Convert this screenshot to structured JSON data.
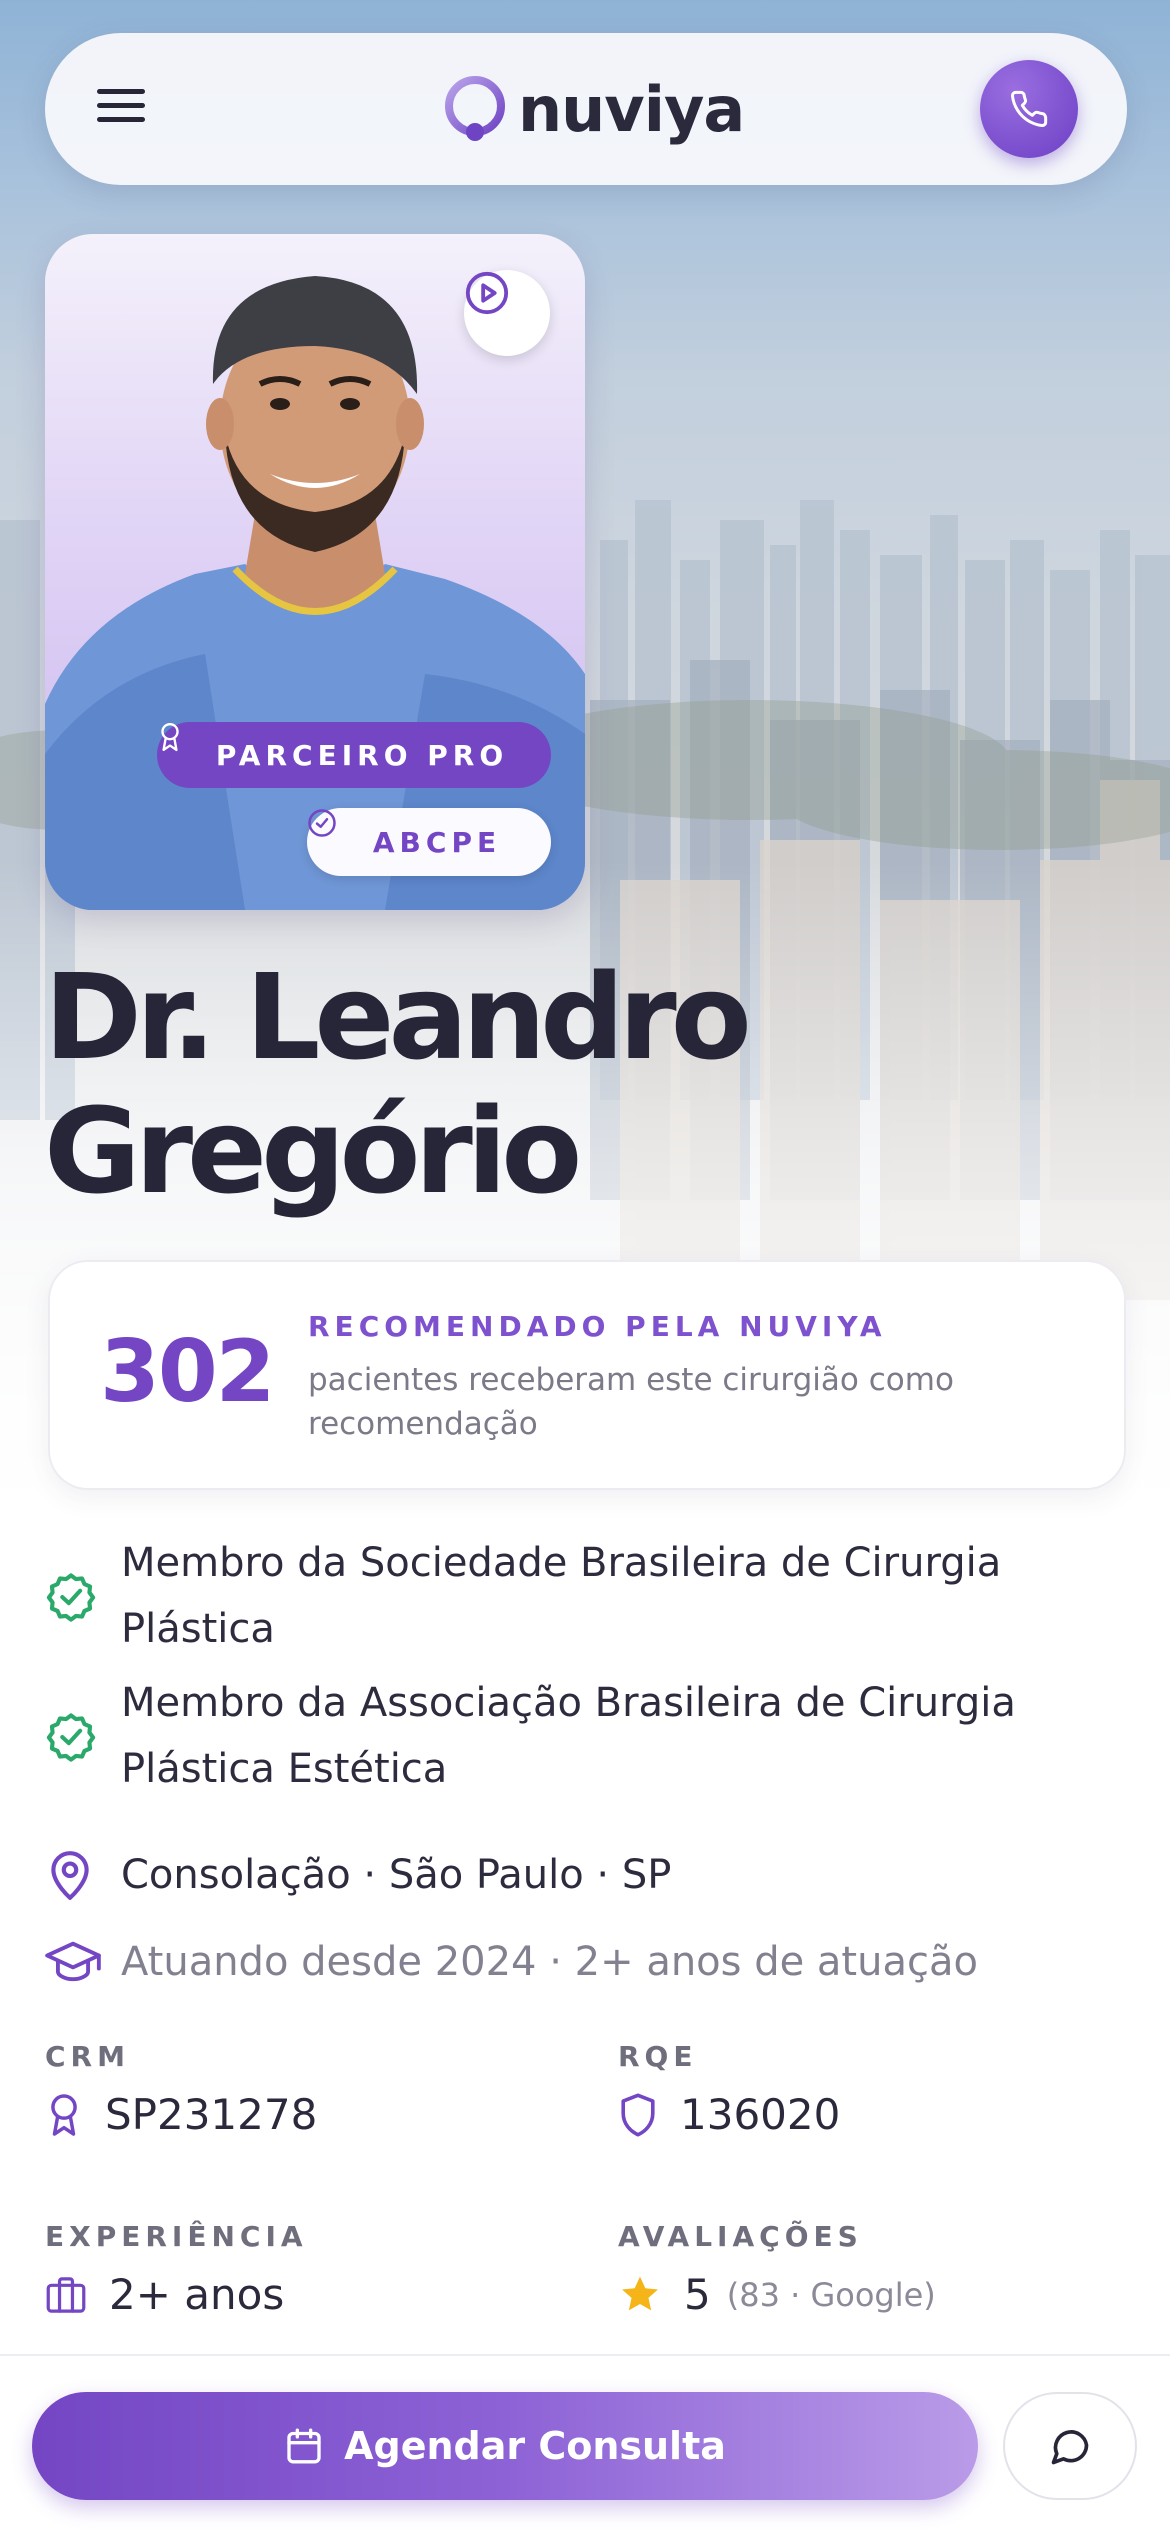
{
  "brand": {
    "name": "nuviya",
    "accent": "#7446c4"
  },
  "header": {
    "menu_icon": "hamburger-menu-icon",
    "call_icon": "phone-icon"
  },
  "profile": {
    "play_icon": "play-circle-icon",
    "badges": {
      "pro": "PARCEIRO PRO",
      "abcpe": "ABCPE"
    },
    "name_line1": "Dr. Leandro",
    "name_line2": "Gregório"
  },
  "recommendation": {
    "count": "302",
    "label": "RECOMENDADO PELA NUVIYA",
    "description": "pacientes receberam este cirurgião como recomendação"
  },
  "credentials": [
    {
      "icon": "verified-check-icon",
      "text": "Membro da Sociedade Brasileira de Cirurgia Plástica"
    },
    {
      "icon": "verified-check-icon",
      "text": "Membro da Associação Brasileira de Cirurgia Plástica Estética"
    }
  ],
  "location": {
    "icon": "map-pin-icon",
    "text": "Consolação · São Paulo · SP"
  },
  "practice": {
    "icon": "graduation-cap-icon",
    "text": "Atuando desde 2024 · 2+ anos de atuação"
  },
  "stats": {
    "crm": {
      "label": "CRM",
      "value": "SP231278",
      "icon": "award-icon"
    },
    "rqe": {
      "label": "RQE",
      "value": "136020",
      "icon": "shield-icon"
    },
    "experience": {
      "label": "EXPERIÊNCIA",
      "value": "2+ anos",
      "icon": "briefcase-icon"
    },
    "reviews": {
      "label": "AVALIAÇÕES",
      "value": "5",
      "sub": "(83 · Google)",
      "icon": "star-icon"
    }
  },
  "bottom_bar": {
    "cta_label": "Agendar Consulta",
    "cta_icon": "calendar-icon",
    "chat_icon": "chat-bubble-icon"
  }
}
